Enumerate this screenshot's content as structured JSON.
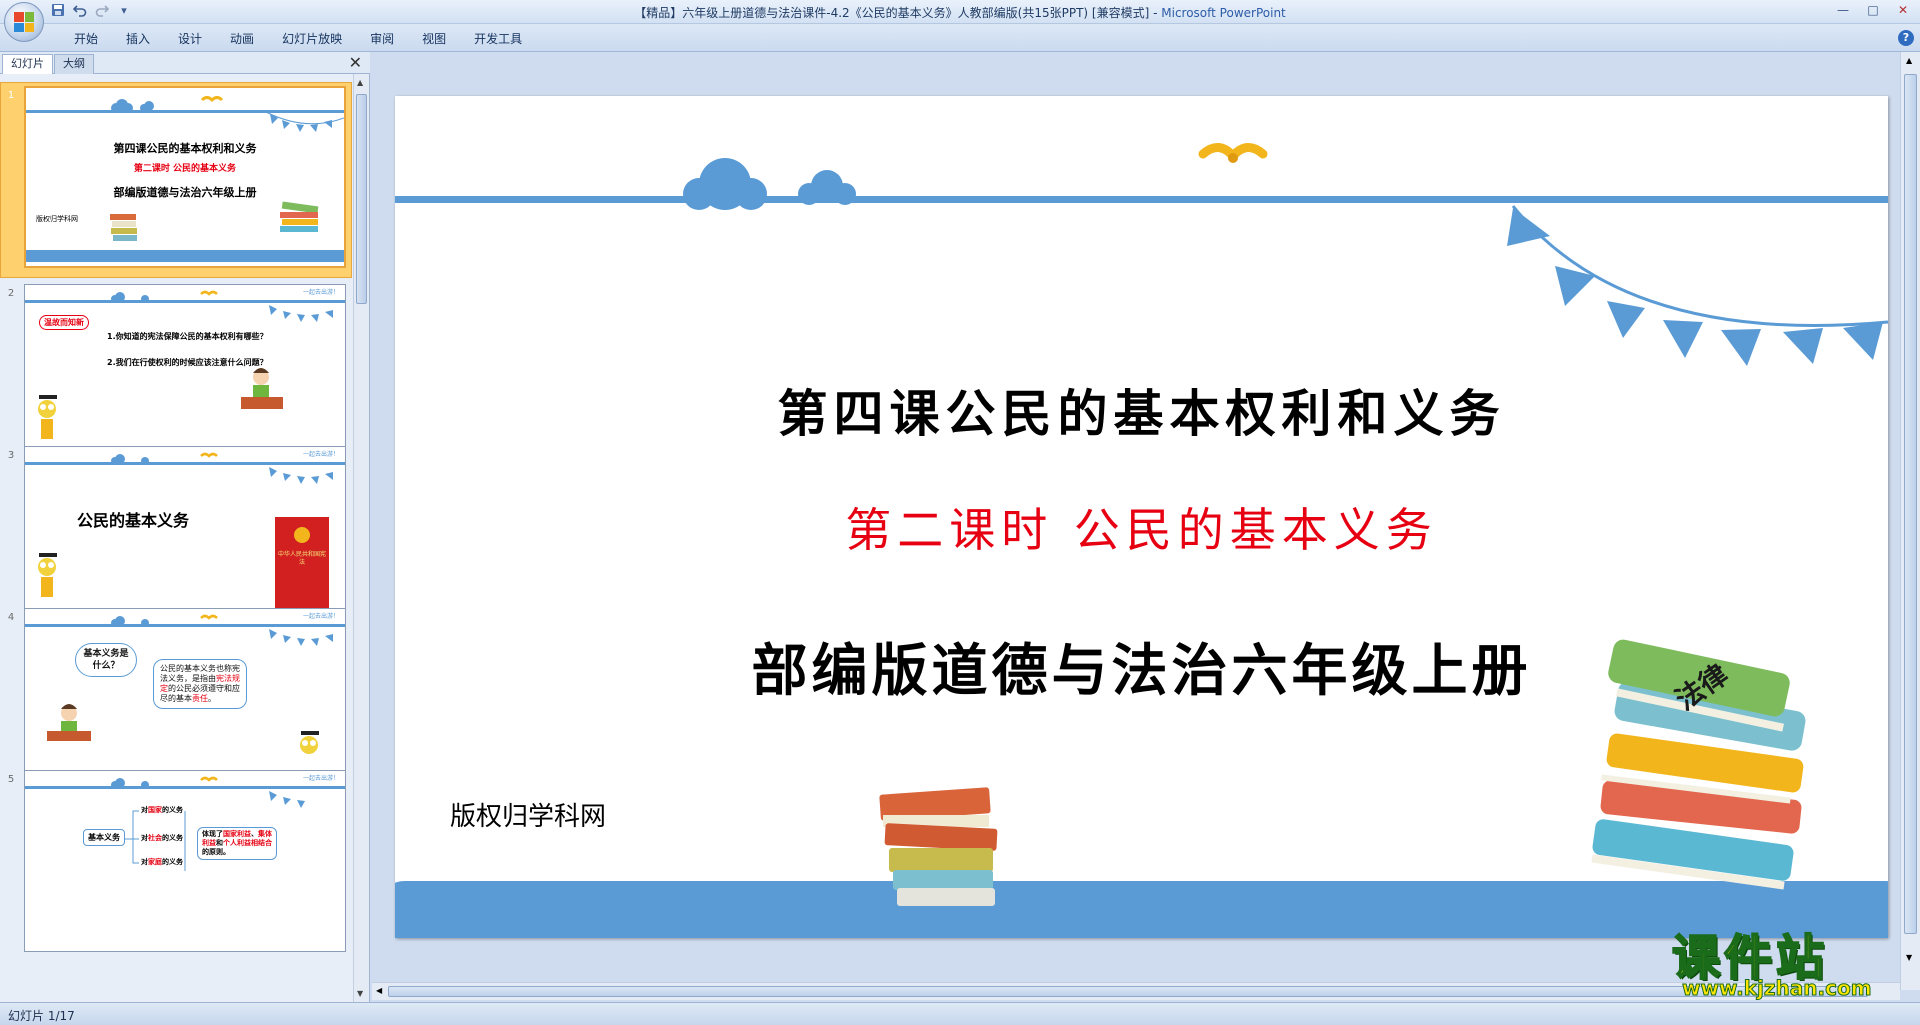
{
  "window": {
    "title_doc": "【精品】六年级上册道德与法治课件-4.2《公民的基本义务》人教部编版(共15张PPT) [兼容模式] - ",
    "title_app": "Microsoft PowerPoint",
    "controls": [
      "—",
      "□",
      "✕"
    ]
  },
  "quick_access": {
    "save_icon": "save-icon",
    "undo_icon": "undo-icon",
    "redo_icon": "redo-icon",
    "customize": "▾"
  },
  "ribbon": {
    "tabs": [
      "开始",
      "插入",
      "设计",
      "动画",
      "幻灯片放映",
      "审阅",
      "视图",
      "开发工具"
    ],
    "help": "?"
  },
  "left_panel": {
    "tab_slides": "幻灯片",
    "tab_outline": "大纲",
    "close": "✕"
  },
  "thumbnails": [
    {
      "number": "1",
      "title": "第四课公民的基本权利和义务",
      "subtitle": "第二课时  公民的基本义务",
      "grade": "部编版道德与法治六年级上册",
      "copyright": "版权归学科网"
    },
    {
      "number": "2",
      "badge": "温故而知新",
      "q1": "1.你知道的宪法保障公民的基本权利有哪些？",
      "q2": "2.我们在行使权利的时候应该注意什么问题？",
      "corner": "一起去出游！"
    },
    {
      "number": "3",
      "heading": "公民的基本义务",
      "book": "中华人民共和国宪法",
      "corner": "一起去出游！"
    },
    {
      "number": "4",
      "bubble_left": "基本义务是什么？",
      "bubble_right_a": "公民的基本义务也称宪法义务，是指由",
      "bubble_right_red1": "宪法规定",
      "bubble_right_b": "的公民必须遵守和应尽的基本",
      "bubble_right_red2": "责任",
      "bubble_right_c": "。",
      "corner": "一起去出游！"
    },
    {
      "number": "5",
      "root": "基本义务",
      "branch1_a": "对",
      "branch1_red": "国家",
      "branch1_b": "的义务",
      "branch2_a": "对",
      "branch2_red": "社会",
      "branch2_b": "的义务",
      "branch3_a": "对",
      "branch3_red": "家庭",
      "branch3_b": "的义务",
      "note_a": "体现了",
      "note_red1": "国家利益",
      "note_b": "、",
      "note_red2": "集体利益",
      "note_c": "和",
      "note_red3": "个人利益相结合",
      "note_d": "的原则。",
      "corner": "一起去出游！"
    }
  ],
  "slide": {
    "main_title": "第四课公民的基本权利和义务",
    "sub_title": "第二课时  公民的基本义务",
    "grade_title": "部编版道德与法治六年级上册",
    "copyright": "版权归学科网",
    "book_label": "法律"
  },
  "status_bar": {
    "slide_position": "幻灯片 1/17"
  },
  "watermark": {
    "name": "课件站",
    "url": "www.kjzhan.com"
  },
  "colors": {
    "accent_blue": "#5b9bd5",
    "title_red": "#e60012",
    "selected_thumb": "#ffd06e"
  }
}
